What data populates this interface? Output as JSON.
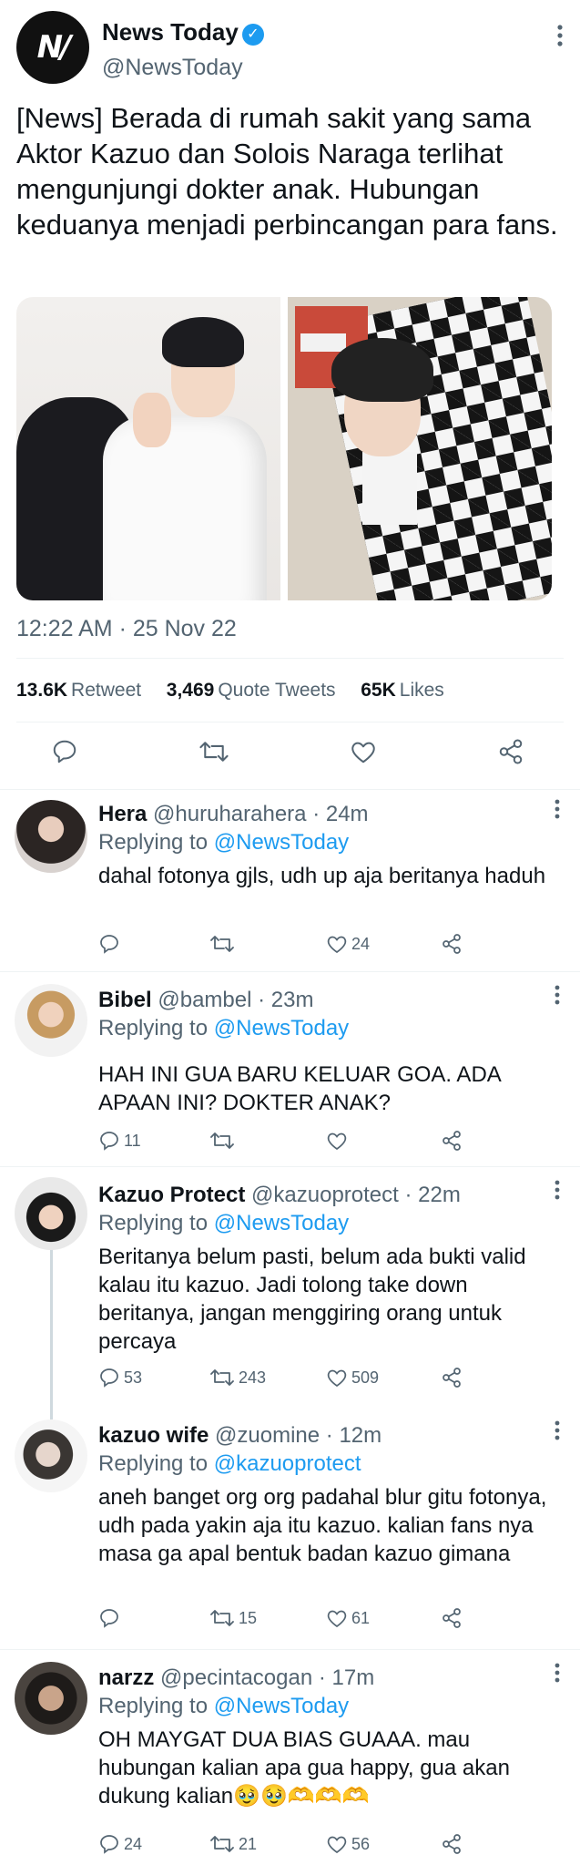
{
  "tweet": {
    "author_name": "News Today",
    "author_handle": "@NewsToday",
    "avatar_text": "N/",
    "text": "[News] Berada di rumah sakit yang sama Aktor Kazuo dan Solois Naraga terlihat mengunjungi dokter anak. Hubungan keduanya menjadi perbincangan para fans.",
    "timestamp": "12:22 AM · 25 Nov 22",
    "stats": {
      "retweets_count": "13.6K",
      "retweets_label": "Retweet",
      "quotes_count": "3,469",
      "quotes_label": "Quote Tweets",
      "likes_count": "65K",
      "likes_label": "Likes"
    }
  },
  "replies": [
    {
      "name": "Hera",
      "handle": "@huruharahera",
      "time": "· 24m",
      "replying_label": "Replying to",
      "replying_to": "@NewsToday",
      "text": "dahal fotonya gjls, udh up aja beritanya haduh",
      "reply_count": "",
      "retweet_count": "",
      "like_count": "24"
    },
    {
      "name": "Bibel",
      "handle": "@bambel",
      "time": "· 23m",
      "replying_label": "Replying to",
      "replying_to": "@NewsToday",
      "text": "HAH INI GUA BARU KELUAR GOA. ADA APAAN INI? DOKTER ANAK?",
      "reply_count": "11",
      "retweet_count": "",
      "like_count": ""
    },
    {
      "name": "Kazuo Protect",
      "handle": "@kazuoprotect",
      "time": "· 22m",
      "replying_label": "Replying to",
      "replying_to": "@NewsToday",
      "text": "Beritanya belum pasti, belum ada bukti valid kalau itu kazuo. Jadi tolong take down beritanya, jangan menggiring orang untuk percaya",
      "reply_count": "53",
      "retweet_count": "243",
      "like_count": "509"
    },
    {
      "name": "kazuo wife",
      "handle": "@zuomine",
      "time": "· 12m",
      "replying_label": "Replying to",
      "replying_to": "@kazuoprotect",
      "text": "aneh banget org org padahal blur gitu fotonya, udh pada yakin aja itu kazuo. kalian fans nya masa ga apal bentuk badan kazuo gimana",
      "reply_count": "",
      "retweet_count": "15",
      "like_count": "61"
    },
    {
      "name": "narzz",
      "handle": "@pecintacogan",
      "time": "· 17m",
      "replying_label": "Replying to",
      "replying_to": "@NewsToday",
      "text": "OH MAYGAT DUA BIAS GUAAA. mau hubungan kalian apa gua happy, gua akan dukung kalian🥹🥹🫶🫶🫶",
      "reply_count": "24",
      "retweet_count": "21",
      "like_count": "56"
    }
  ],
  "icons": {
    "verified": "verified-badge-icon",
    "reply": "reply-icon",
    "retweet": "retweet-icon",
    "like": "heart-icon",
    "share": "share-icon",
    "more": "more-icon"
  },
  "colors": {
    "accent": "#1d9bf0",
    "secondary_text": "#536471",
    "primary_text": "#0f1419"
  }
}
